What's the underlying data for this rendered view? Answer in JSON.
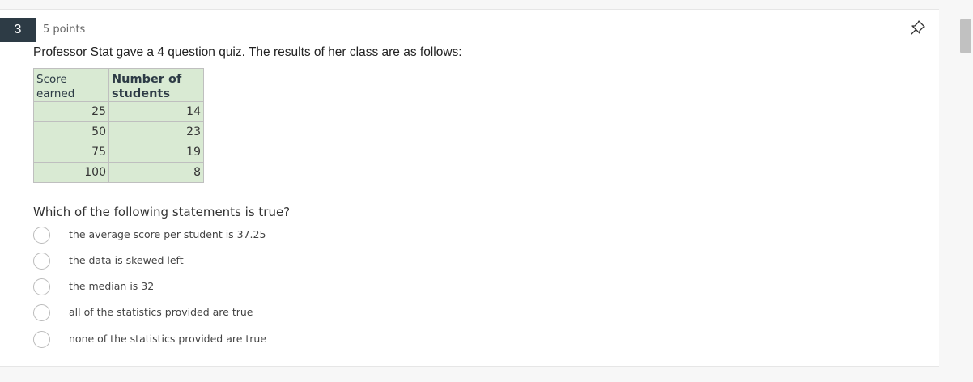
{
  "question": {
    "number": "3",
    "points": "5 points",
    "prompt": "Professor Stat gave a 4 question quiz. The results of her class are as follows:",
    "table": {
      "headers": [
        "Score earned",
        "Number of students"
      ],
      "rows": [
        [
          "25",
          "14"
        ],
        [
          "50",
          "23"
        ],
        [
          "75",
          "19"
        ],
        [
          "100",
          "8"
        ]
      ]
    },
    "text": "Which of the following statements is true?",
    "answers": [
      "the average score per student is 37.25",
      "the data is skewed left",
      "the median is 32",
      "all of the statistics provided are true",
      "none of the statistics provided are true"
    ]
  },
  "icons": {
    "pin": "pin-icon"
  }
}
